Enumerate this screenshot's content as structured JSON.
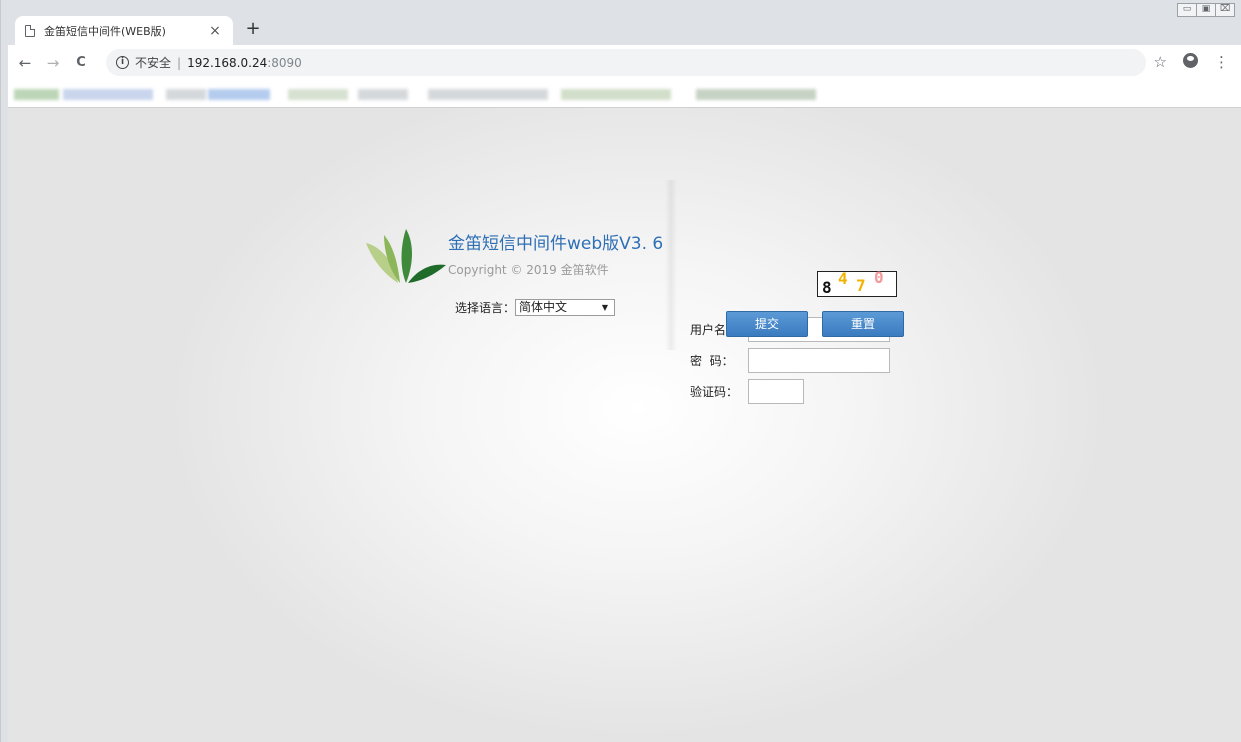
{
  "browser": {
    "tab_title": "金笛短信中间件(WEB版)",
    "tab_close": "×",
    "new_tab": "+",
    "nav": {
      "back": "←",
      "forward": "→",
      "reload": "C"
    },
    "address": {
      "info_icon": "i",
      "insecure_label": "不安全",
      "separator": "|",
      "host": "192.168.0.24",
      "port": ":8090"
    },
    "toolbar_right": {
      "star": "☆",
      "menu": "⋮"
    },
    "window_controls": {
      "minimize": "▭",
      "maximize": "▣",
      "close": "⌧"
    }
  },
  "login": {
    "brand_title": "金笛短信中间件web版V3. 6",
    "copyright": "Copyright © 2019 金笛软件",
    "language_label": "选择语言：",
    "language_selected": "简体中文",
    "fields": {
      "username_label": "用户名：",
      "password_label": "密  码：",
      "captcha_label": "验证码："
    },
    "captcha_digits": [
      {
        "char": "8",
        "color": "#111111"
      },
      {
        "char": "4",
        "color": "#f0b400"
      },
      {
        "char": "7",
        "color": "#f0b400"
      },
      {
        "char": "0",
        "color": "#f59a9a"
      }
    ],
    "submit_label": "提交",
    "reset_label": "重置"
  },
  "colors": {
    "brand": "#2e6fb5",
    "button": "#3a7bc0"
  }
}
